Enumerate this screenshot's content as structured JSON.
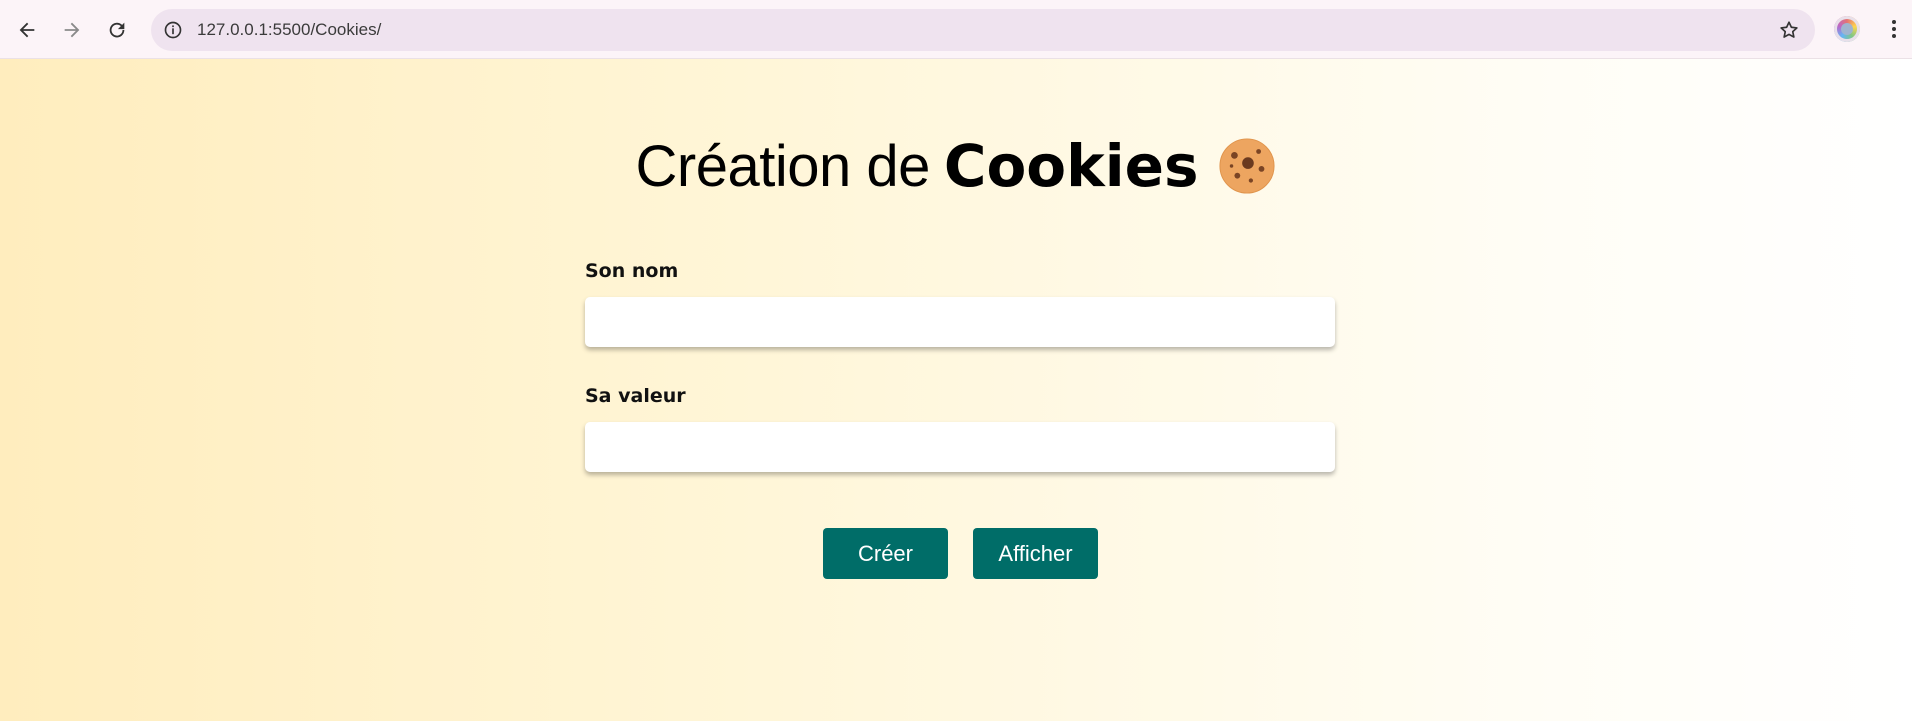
{
  "browser": {
    "url": "127.0.0.1:5500/Cookies/",
    "icons": {
      "back": "arrow-left-icon",
      "forward": "arrow-right-icon",
      "reload": "reload-icon",
      "site_info": "info-icon",
      "bookmark": "star-icon",
      "profile": "profile-avatar",
      "menu": "kebab-menu-icon"
    }
  },
  "page": {
    "title_light": "Création de",
    "title_bold": "Cookies",
    "title_emoji": "cookie-icon",
    "form": {
      "name_label": "Son nom",
      "name_value": "",
      "value_label": "Sa valeur",
      "value_value": ""
    },
    "buttons": {
      "create": "Créer",
      "show": "Afficher"
    }
  },
  "colors": {
    "button_bg": "#006d68",
    "page_gradient_start": "#ffedbe",
    "page_gradient_end": "#ffffff",
    "omnibox_bg": "#efe3ef"
  }
}
